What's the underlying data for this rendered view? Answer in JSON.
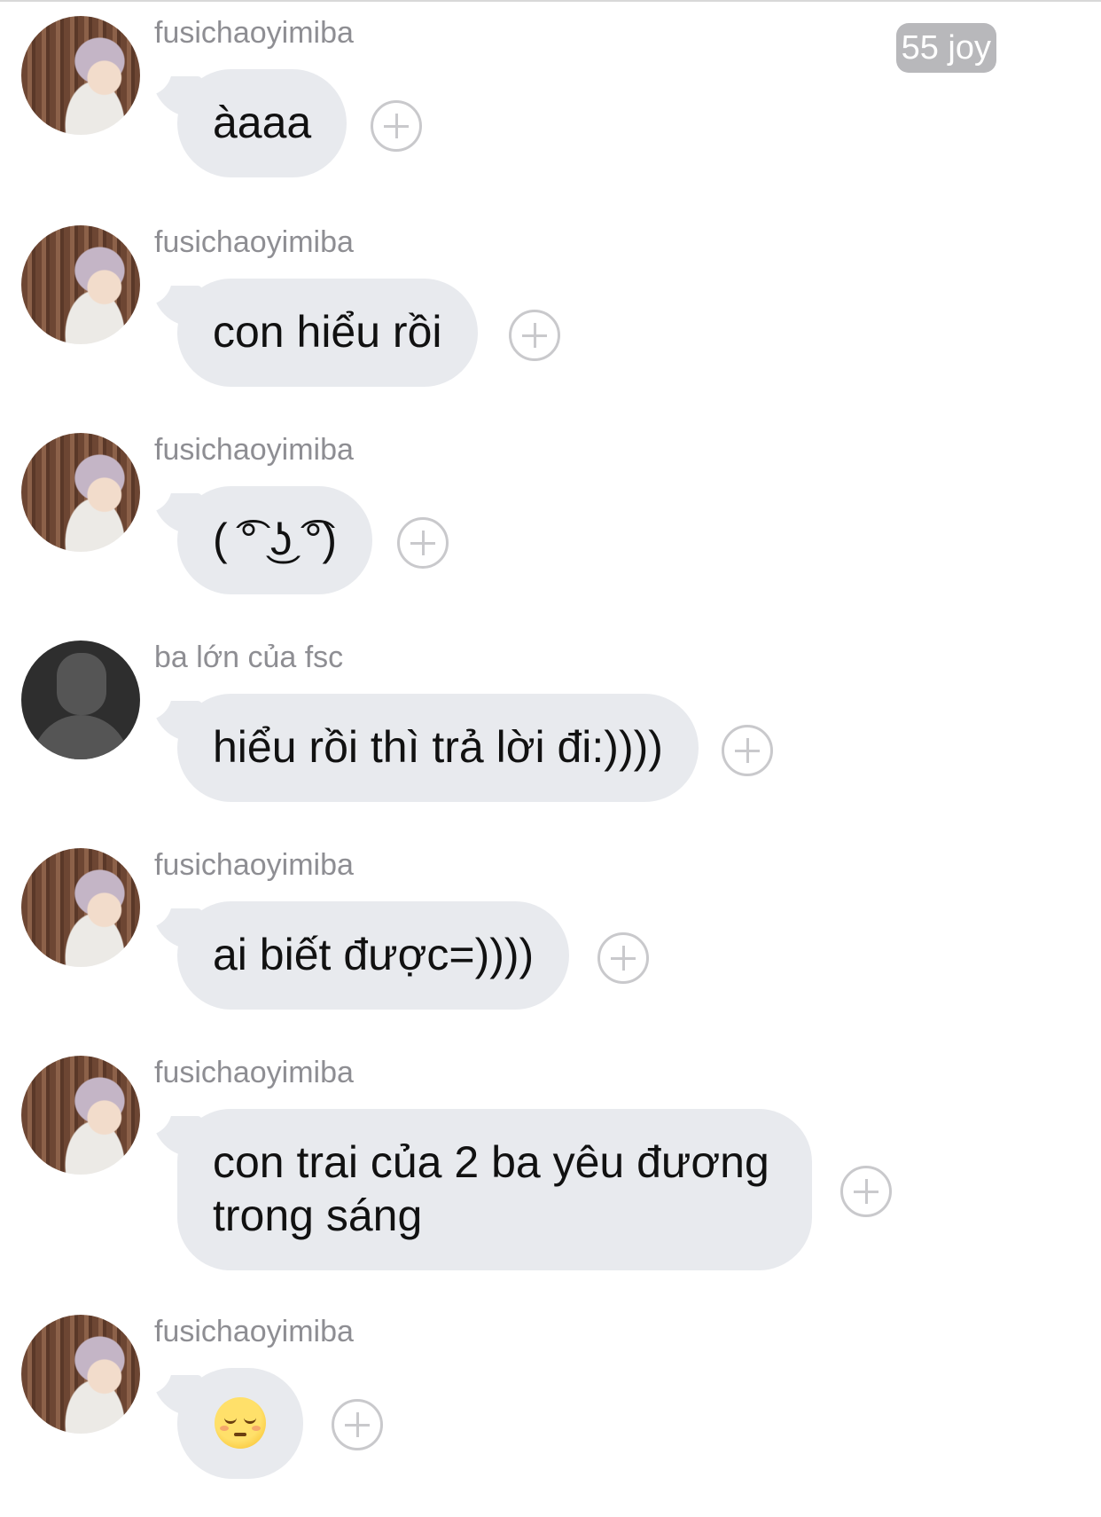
{
  "badge": {
    "text": "55 joy"
  },
  "messages": [
    {
      "sender": "fusichaoyimiba",
      "text": "àaaa",
      "avatar": "profile-photo"
    },
    {
      "sender": "fusichaoyimiba",
      "text": "con hiểu rồi",
      "avatar": "profile-photo"
    },
    {
      "sender": "fusichaoyimiba",
      "text": "( ͡° ͜ʖ ͡°)",
      "avatar": "profile-photo"
    },
    {
      "sender": "ba lớn của fsc",
      "text": "hiểu rồi thì trả lời đi:))))",
      "avatar": "default-silhouette"
    },
    {
      "sender": "fusichaoyimiba",
      "text": "ai biết được=))))",
      "avatar": "profile-photo"
    },
    {
      "sender": "fusichaoyimiba",
      "text": "con trai của 2 ba yêu đương trong sáng",
      "avatar": "profile-photo"
    },
    {
      "sender": "fusichaoyimiba",
      "text": "😌",
      "emoji_name": "relieved-face",
      "avatar": "profile-photo"
    }
  ],
  "colors": {
    "bubble": "#e8eaee",
    "sender_text": "#8e8e93",
    "badge": "#b8b8bb"
  },
  "icons": {
    "add_reaction": "plus-circle-icon"
  }
}
